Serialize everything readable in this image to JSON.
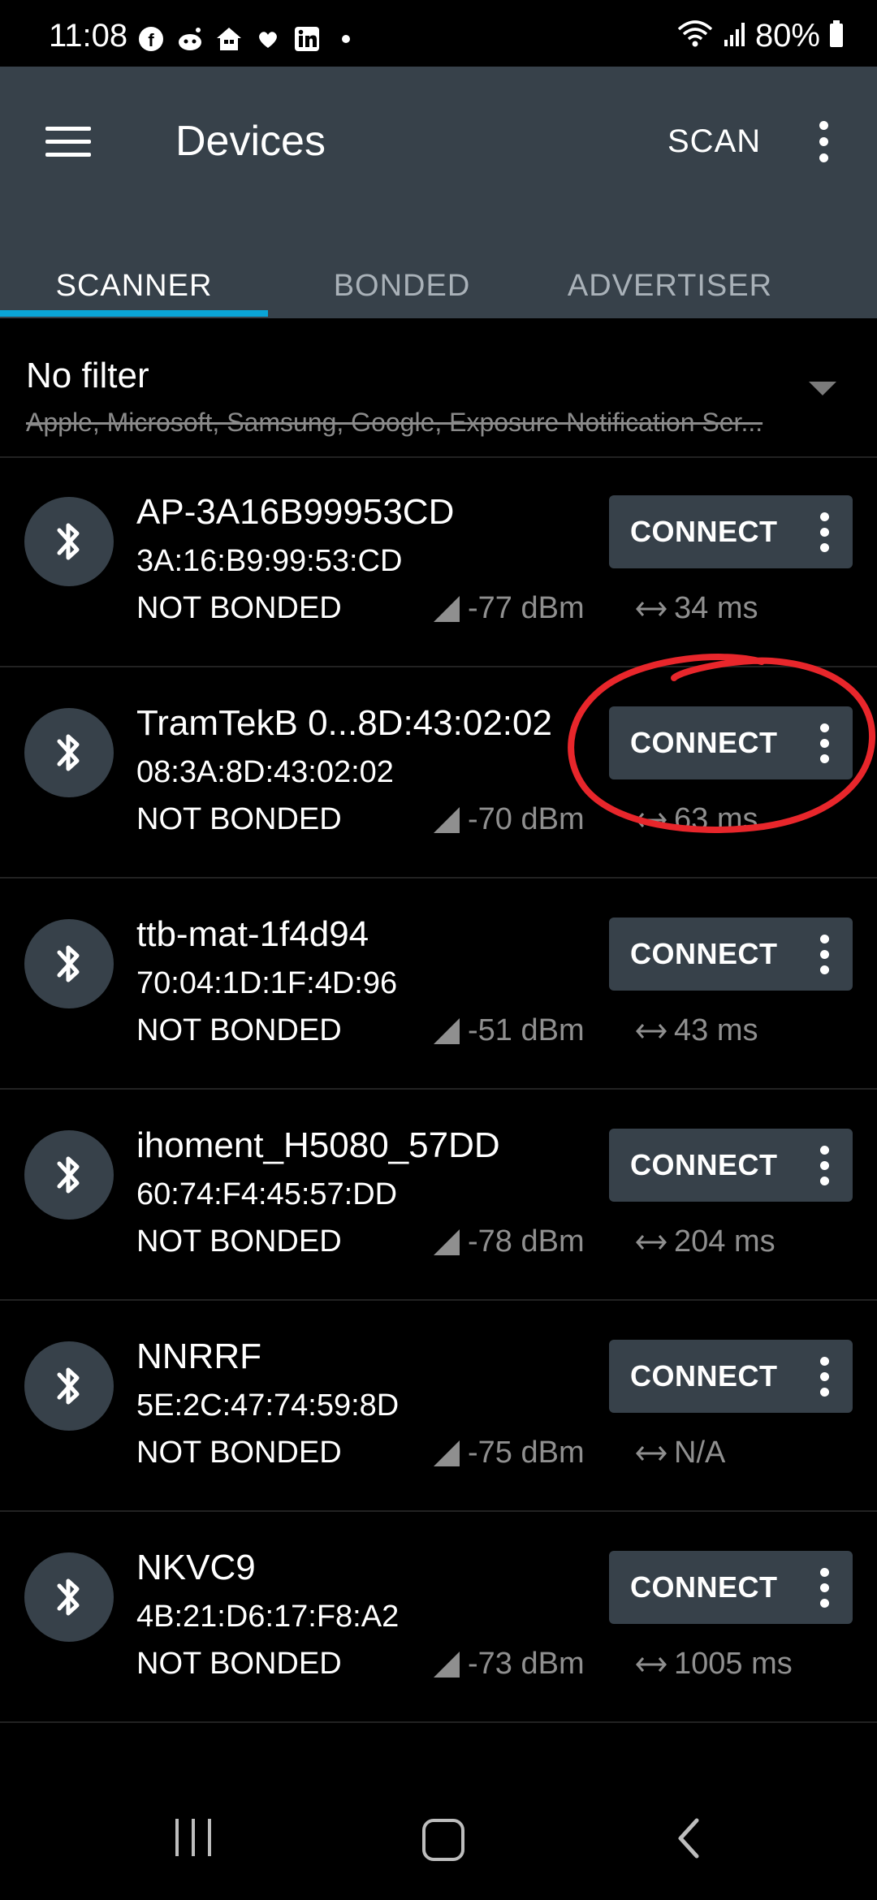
{
  "status_bar": {
    "time": "11:08",
    "notification_icons": [
      "facebook-icon",
      "reddit-icon",
      "home-icon",
      "heart-icon",
      "linkedin-icon",
      "dot-icon"
    ],
    "battery": "80%"
  },
  "app_bar": {
    "title": "Devices",
    "scan_label": "SCAN"
  },
  "tabs": [
    {
      "label": "SCANNER",
      "active": true
    },
    {
      "label": "BONDED",
      "active": false
    },
    {
      "label": "ADVERTISER",
      "active": false
    }
  ],
  "filter": {
    "title": "No filter",
    "subtitle": "Apple, Microsoft, Samsung, Google, Exposure Notification Ser..."
  },
  "devices": [
    {
      "name": "AP-3A16B99953CD",
      "address": "3A:16:B9:99:53:CD",
      "bond_state": "NOT BONDED",
      "rssi": "-77 dBm",
      "interval": "34 ms",
      "connect_label": "CONNECT"
    },
    {
      "name": "TramTekB 0...8D:43:02:02",
      "address": "08:3A:8D:43:02:02",
      "bond_state": "NOT BONDED",
      "rssi": "-70 dBm",
      "interval": "63 ms",
      "connect_label": "CONNECT"
    },
    {
      "name": "ttb-mat-1f4d94",
      "address": "70:04:1D:1F:4D:96",
      "bond_state": "NOT BONDED",
      "rssi": "-51 dBm",
      "interval": "43 ms",
      "connect_label": "CONNECT"
    },
    {
      "name": "ihoment_H5080_57DD",
      "address": "60:74:F4:45:57:DD",
      "bond_state": "NOT BONDED",
      "rssi": "-78 dBm",
      "interval": "204 ms",
      "connect_label": "CONNECT"
    },
    {
      "name": "NNRRF",
      "address": "5E:2C:47:74:59:8D",
      "bond_state": "NOT BONDED",
      "rssi": "-75 dBm",
      "interval": "N/A",
      "connect_label": "CONNECT"
    },
    {
      "name": "NKVC9",
      "address": "4B:21:D6:17:F8:A2",
      "bond_state": "NOT BONDED",
      "rssi": "-73 dBm",
      "interval": "1005 ms",
      "connect_label": "CONNECT"
    }
  ],
  "colors": {
    "app_bar": "#37414a",
    "tab_indicator": "#0aa4d6",
    "annotation": "#e8262b"
  }
}
